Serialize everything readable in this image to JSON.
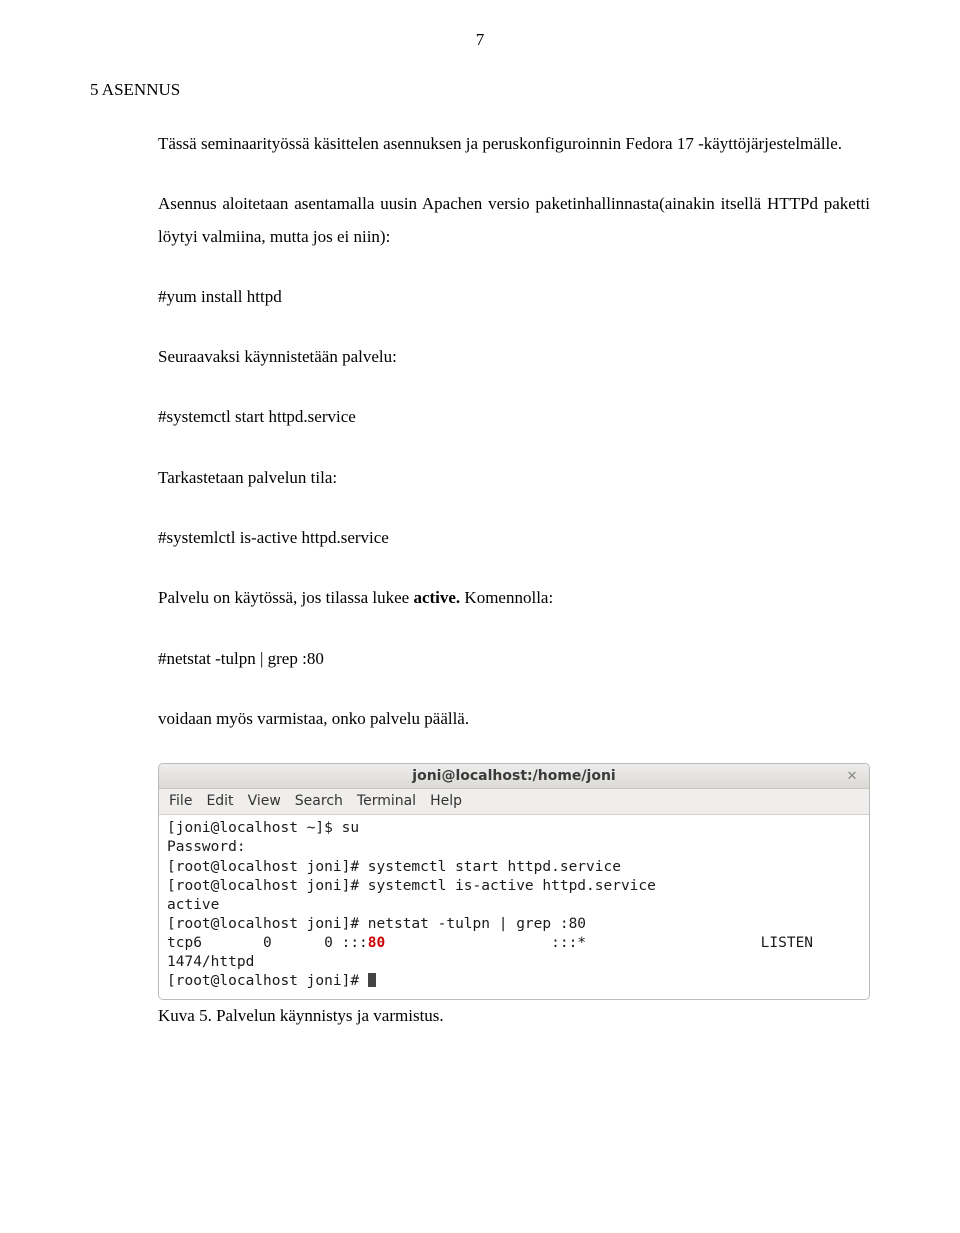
{
  "page_number": "7",
  "section_heading": "5  ASENNUS",
  "para_intro": "Tässä seminaarityössä käsittelen asennuksen ja peruskonfiguroinnin Fedora 17 -käyttöjärjestelmälle.",
  "para_install_intro": "Asennus aloitetaan asentamalla uusin Apachen versio paketinhallinnasta(ainakin itsellä HTTPd paketti löytyi valmiina, mutta jos ei niin):",
  "cmd_yum": "#yum install httpd",
  "para_start": "Seuraavaksi käynnistetään palvelu:",
  "cmd_start": "#systemctl start httpd.service",
  "para_check": "Tarkastetaan palvelun tila:",
  "cmd_isactive": "#systemlctl is-active httpd.service",
  "para_status_pre": "Palvelu on käytössä, jos tilassa lukee ",
  "para_status_bold": "active.",
  "para_status_post": " Komennolla:",
  "cmd_netstat": "#netstat -tulpn | grep :80",
  "para_verify": "voidaan myös varmistaa, onko palvelu päällä.",
  "terminal": {
    "title": "joni@localhost:/home/joni",
    "menu": {
      "file": "File",
      "edit": "Edit",
      "view": "View",
      "search": "Search",
      "terminal": "Terminal",
      "help": "Help"
    },
    "lines": [
      "[joni@localhost ~]$ su",
      "Password:",
      "[root@localhost joni]# systemctl start httpd.service",
      "[root@localhost joni]# systemctl is-active httpd.service",
      "active",
      "[root@localhost joni]# netstat -tulpn | grep :80"
    ],
    "netstat_line": {
      "left": "tcp6       0      0 :::",
      "port": "80",
      "mid": "                   :::*                    LISTEN     ",
      "pid_line": "1474/httpd"
    },
    "last_prompt": "[root@localhost joni]# "
  },
  "caption": "Kuva 5. Palvelun käynnistys ja varmistus."
}
